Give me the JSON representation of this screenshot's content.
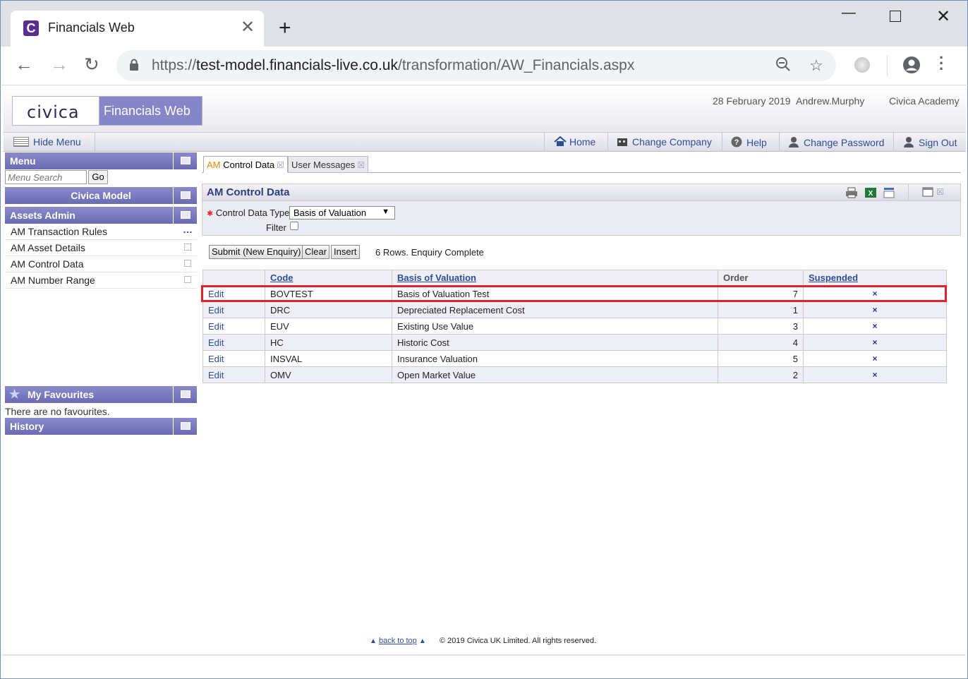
{
  "browser": {
    "tab_title": "Financials Web",
    "url_scheme": "https://",
    "url_host": "test-model.financials-live.co.uk",
    "url_path": "/transformation/AW_Financials.aspx"
  },
  "header": {
    "logo_text": "civica",
    "app_name": "Financials Web",
    "date": "28 February 2019",
    "user": "Andrew.Murphy",
    "company": "Civica Academy"
  },
  "menubar": {
    "hide_menu": "Hide Menu",
    "home": "Home",
    "change_company": "Change Company",
    "help": "Help",
    "change_password": "Change Password",
    "sign_out": "Sign Out"
  },
  "sidebar": {
    "menu_title": "Menu",
    "search_placeholder": "Menu Search",
    "go": "Go",
    "model_title": "Civica Model",
    "section_title": "Assets Admin",
    "items": [
      {
        "label": "AM Transaction Rules"
      },
      {
        "label": "AM Asset Details"
      },
      {
        "label": "AM Control Data"
      },
      {
        "label": "AM Number Range"
      }
    ],
    "favourites_title": "My Favourites",
    "no_favourites": "There are no favourites.",
    "history_title": "History"
  },
  "tabs": [
    {
      "prefix": "AM",
      "label": " Control Data"
    },
    {
      "label": "User Messages"
    }
  ],
  "panel": {
    "title": "AM Control Data",
    "control_type_label": "Control Data Type",
    "control_type_value": "Basis of Valuation",
    "filter_label": "Filter"
  },
  "actions": {
    "submit": "Submit (New Enquiry)",
    "clear": "Clear",
    "insert": "Insert",
    "status": "6 Rows. Enquiry Complete"
  },
  "grid": {
    "columns": [
      "",
      "Code",
      "Basis of Valuation",
      "Order",
      "Suspended"
    ],
    "rows": [
      {
        "edit": "Edit",
        "code": "BOVTEST",
        "basis": "Basis of Valuation Test",
        "order": "7",
        "suspended": "×"
      },
      {
        "edit": "Edit",
        "code": "DRC",
        "basis": "Depreciated Replacement Cost",
        "order": "1",
        "suspended": "×"
      },
      {
        "edit": "Edit",
        "code": "EUV",
        "basis": "Existing Use Value",
        "order": "3",
        "suspended": "×"
      },
      {
        "edit": "Edit",
        "code": "HC",
        "basis": "Historic Cost",
        "order": "4",
        "suspended": "×"
      },
      {
        "edit": "Edit",
        "code": "INSVAL",
        "basis": "Insurance Valuation",
        "order": "5",
        "suspended": "×"
      },
      {
        "edit": "Edit",
        "code": "OMV",
        "basis": "Open Market Value",
        "order": "2",
        "suspended": "×"
      }
    ]
  },
  "footer": {
    "back_to_top": "back to top",
    "copyright": "© 2019 Civica UK Limited. All rights reserved."
  },
  "colors": {
    "accent": "#8585c7",
    "link": "#2c4e9a",
    "highlight": "#e0202a"
  }
}
